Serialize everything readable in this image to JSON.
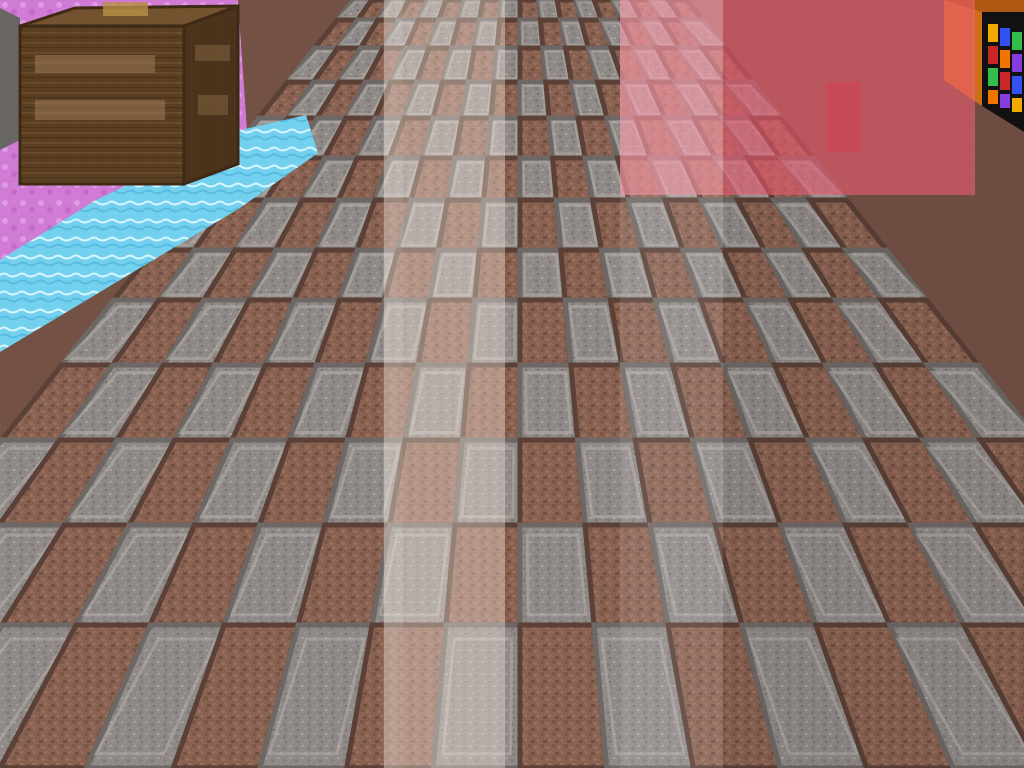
{
  "scene": {
    "view": "first-person",
    "game_style": "block-voxel",
    "floor": {
      "pattern": "checkerboard",
      "tile_types": [
        "polished-stone-slab",
        "terracotta-brick"
      ],
      "colors": {
        "brick": "#8a6252",
        "brick_dark": "#6c4c40",
        "stone": "#8f8987",
        "stone_light": "#b1aaa7",
        "stone_dark": "#666160"
      }
    },
    "overlays": [
      {
        "type": "light-beam",
        "color": "#fff1e7"
      },
      {
        "type": "red-glass-highlight",
        "color": "#ff6f86"
      }
    ],
    "objects": [
      {
        "type": "sign-block",
        "name": "carved-note-block",
        "text": "",
        "color": "#5a3e22"
      },
      {
        "type": "water-strip",
        "name": "water-canal",
        "color": "#73d1ef"
      },
      {
        "type": "pink-wall",
        "name": "pink-block-wall",
        "color": "#d07bd4"
      },
      {
        "type": "rainbow-block",
        "name": "rainbow-cube",
        "colors": [
          "#ffb300",
          "#3456ff",
          "#37c84f",
          "#d62929",
          "#ff7b00",
          "#8e3fe8"
        ]
      }
    ]
  }
}
